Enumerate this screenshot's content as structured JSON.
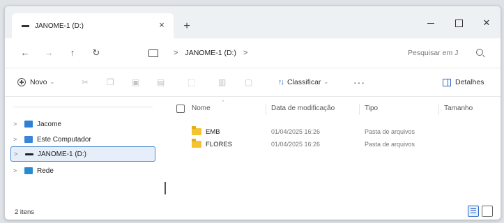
{
  "tab": {
    "title": "JANOME-1 (D:)",
    "close_symbol": "×",
    "new_tab_symbol": "+"
  },
  "window_controls": {
    "close_symbol": "✕"
  },
  "nav_buttons": {
    "back": "←",
    "forward": "→",
    "up": "↑",
    "refresh": "↻"
  },
  "address": {
    "separator": ">",
    "crumb": "JANOME-1 (D:)",
    "trailing_separator": ">"
  },
  "search": {
    "placeholder": "Pesquisar em J"
  },
  "command_bar": {
    "new_label": "Novo",
    "caret": "⌄",
    "sort_label": "Classificar",
    "more_label": "···",
    "details_label": "Detalhes"
  },
  "nav_pane": {
    "items": [
      {
        "label": "Jacome",
        "expander": ">"
      },
      {
        "label": "Este Computador",
        "expander": ">"
      },
      {
        "label": "JANOME-1 (D:)",
        "expander": ">"
      },
      {
        "label": "Rede",
        "expander": ">"
      }
    ]
  },
  "columns": {
    "name": "Nome",
    "date": "Data de modificação",
    "type": "Tipo",
    "size": "Tamanho"
  },
  "files": [
    {
      "name": "EMB",
      "date": "01/04/2025 16:26",
      "type": "Pasta de arquivos"
    },
    {
      "name": "FLORES",
      "date": "01/04/2025 16:26",
      "type": "Pasta de arquivos"
    }
  ],
  "status": {
    "count": "2 itens"
  },
  "colors": {
    "accent": "#2a67c9",
    "folder": "#f4c430",
    "selection_bg": "#e6eef9"
  }
}
